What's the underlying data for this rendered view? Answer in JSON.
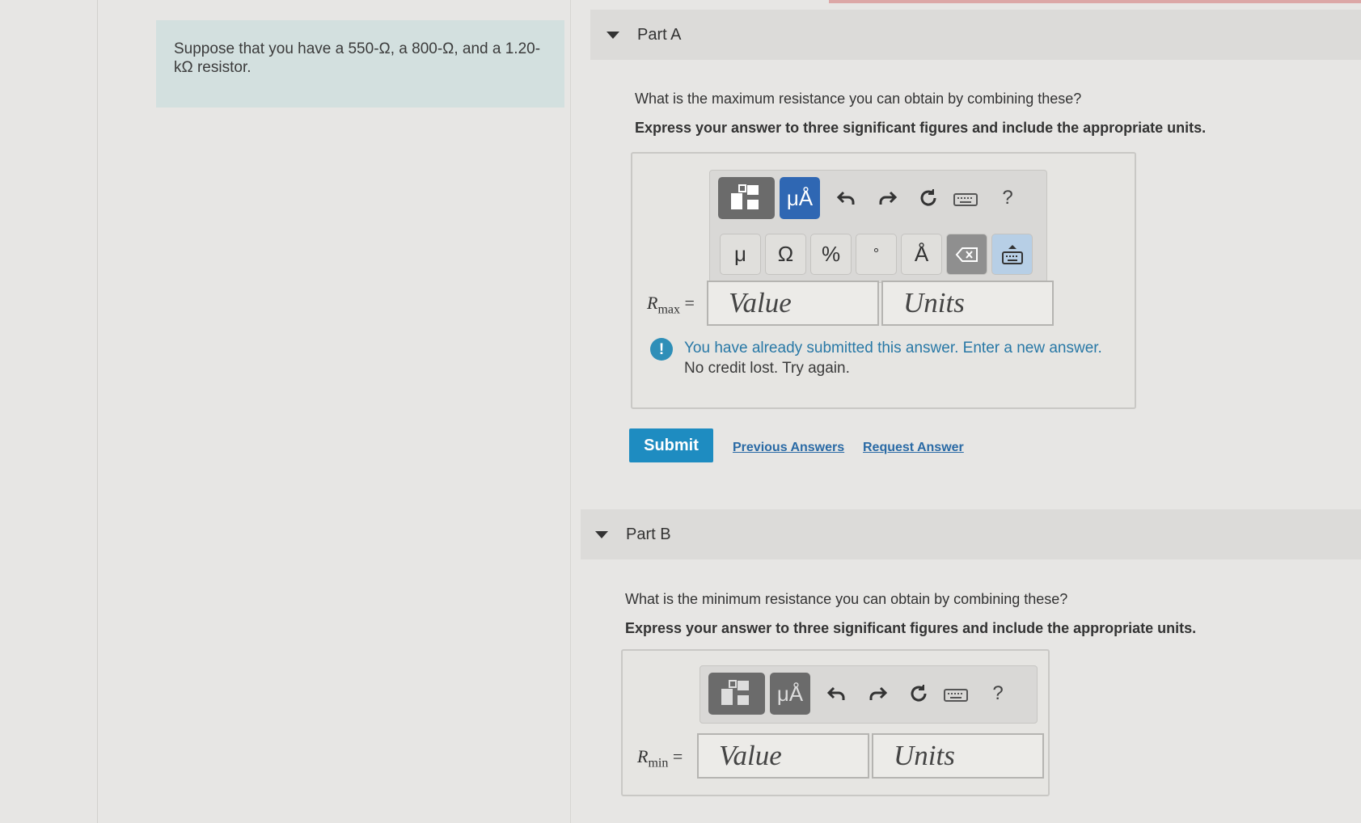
{
  "intro": {
    "text": "Suppose that you have a 550-Ω, a 800-Ω, and a 1.20-kΩ resistor."
  },
  "partA": {
    "title": "Part A",
    "question": "What is the maximum resistance you can obtain by combining these?",
    "instruction": "Express your answer to three significant figures and include the appropriate units.",
    "toolbar": {
      "unit_button": "μÅ",
      "help": "?"
    },
    "keys": [
      "μ",
      "Ω",
      "%",
      "°",
      "Å"
    ],
    "label_var": "R",
    "label_sub": "max",
    "label_eq": " =",
    "value_placeholder": "Value",
    "units_placeholder": "Units",
    "warning_line1": "You have already submitted this answer. Enter a new answer.",
    "warning_line2": "No credit lost. Try again.",
    "submit": "Submit",
    "previous_answers": "Previous Answers",
    "request_answer": "Request Answer"
  },
  "partB": {
    "title": "Part B",
    "question": "What is the minimum resistance you can obtain by combining these?",
    "instruction": "Express your answer to three significant figures and include the appropriate units.",
    "toolbar": {
      "unit_button": "μÅ",
      "help": "?"
    },
    "label_var": "R",
    "label_sub": "min",
    "label_eq": " =",
    "value_placeholder": "Value",
    "units_placeholder": "Units"
  },
  "colors": {
    "submit": "#1e8cc1",
    "link": "#2a6aa5",
    "warning": "#2f8fb8",
    "unit_button": "#2f67b3"
  }
}
